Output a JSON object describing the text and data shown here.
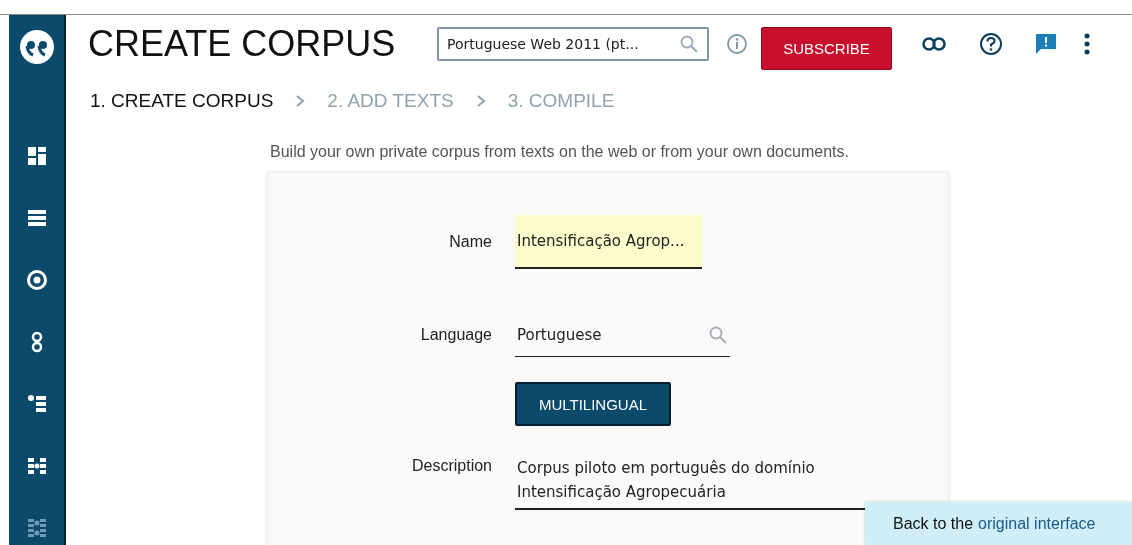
{
  "header": {
    "title": "CREATE CORPUS",
    "corpus_search": {
      "value": "Portuguese Web 2011 (pt..."
    },
    "subscribe_button": "SUBSCRIBE"
  },
  "sidebar": {
    "items": [
      {
        "kind": "dashboard",
        "disabled": false
      },
      {
        "kind": "list",
        "disabled": false
      },
      {
        "kind": "target",
        "disabled": false
      },
      {
        "kind": "rings",
        "disabled": false
      },
      {
        "kind": "bullets",
        "disabled": false
      },
      {
        "kind": "network",
        "disabled": false
      },
      {
        "kind": "network2",
        "disabled": true
      }
    ]
  },
  "steps": [
    {
      "label": "1. CREATE CORPUS",
      "selected": true
    },
    {
      "label": "2. ADD TEXTS",
      "selected": false
    },
    {
      "label": "3. COMPILE",
      "selected": false
    }
  ],
  "intro": "Build your own private corpus from texts on the web or from your own documents.",
  "form": {
    "fields": [
      {
        "kind": "text",
        "label": "Name",
        "value": "Intensificação Agrop...",
        "highlighted": true
      },
      {
        "kind": "search",
        "label": "Language",
        "value": "Portuguese",
        "highlighted": false
      },
      {
        "kind": "button",
        "label": "MULTILINGUAL"
      },
      {
        "kind": "textarea",
        "label": "Description",
        "value": "Corpus piloto em português do domínio\nIntensificação Agropecuária",
        "highlighted": false
      }
    ]
  },
  "banner": {
    "text": "Back to the",
    "link": "original interface"
  }
}
